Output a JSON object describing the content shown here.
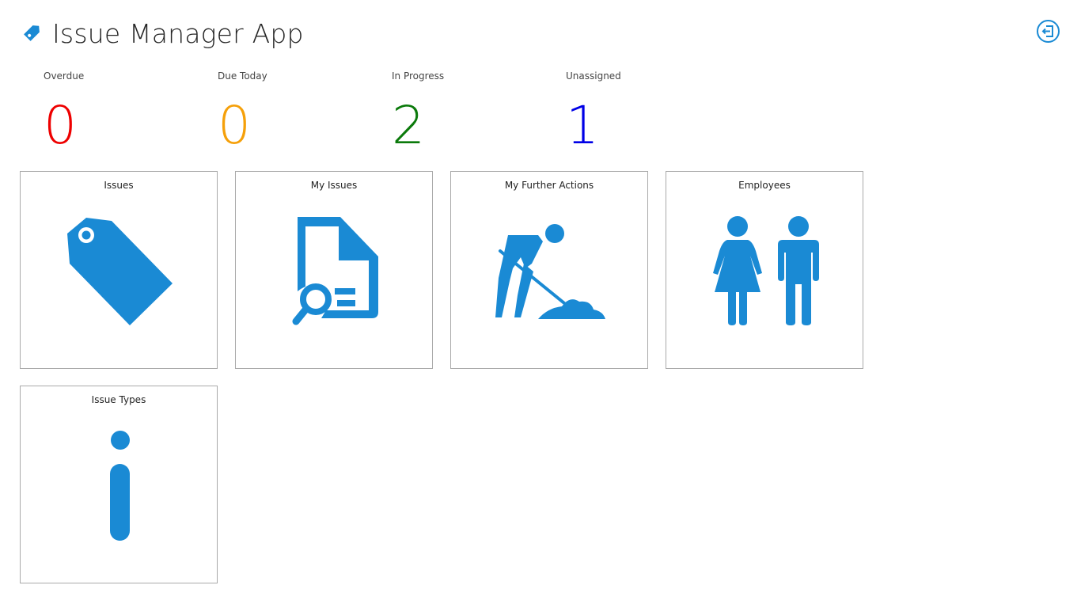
{
  "app": {
    "title": "Issue Manager App",
    "accent_color": "#1a8ad4",
    "logo_icon": "tag-icon",
    "exit_icon": "sign-out-icon"
  },
  "stats": [
    {
      "label": "Overdue",
      "count": "0",
      "color": "#ee0000"
    },
    {
      "label": "Due Today",
      "count": "0",
      "color": "#f5a00a"
    },
    {
      "label": "In Progress",
      "count": "2",
      "color": "#0b7a0b"
    },
    {
      "label": "Unassigned",
      "count": "1",
      "color": "#0000e6"
    }
  ],
  "tiles": [
    {
      "label": "Issues",
      "icon": "tag-icon"
    },
    {
      "label": "My Issues",
      "icon": "document-search-icon"
    },
    {
      "label": "My Further Actions",
      "icon": "worker-shovel-icon"
    },
    {
      "label": "Employees",
      "icon": "people-icon"
    },
    {
      "label": "Issue Types",
      "icon": "info-icon"
    }
  ]
}
